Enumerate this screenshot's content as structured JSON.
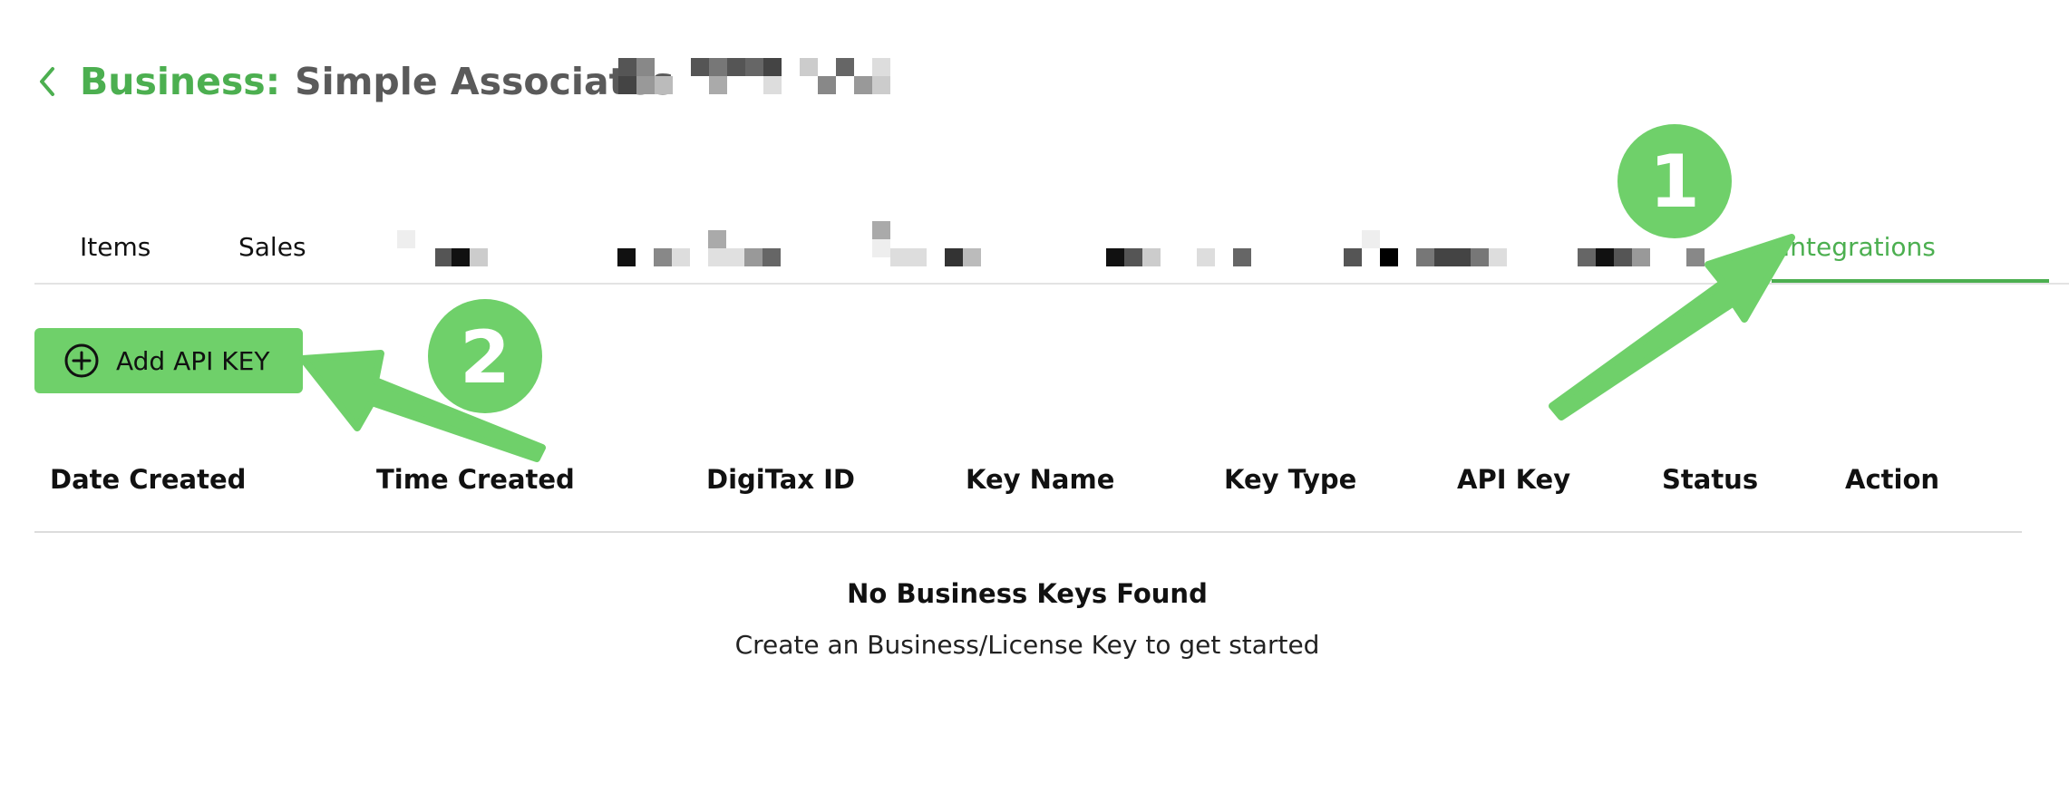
{
  "header": {
    "back_icon": "chevron-left-icon",
    "label": "Business:",
    "name": "Simple Associates"
  },
  "tabs": [
    {
      "label": "Items"
    },
    {
      "label": "Sales"
    },
    {
      "label": "Integrations",
      "active": true
    }
  ],
  "add_button": {
    "label": "Add API KEY",
    "icon": "plus-circle-icon"
  },
  "table": {
    "columns": [
      "Date Created",
      "Time Created",
      "DigiTax ID",
      "Key Name",
      "Key Type",
      "API Key",
      "Status",
      "Action"
    ]
  },
  "empty_state": {
    "title": "No Business Keys Found",
    "subtitle": "Create an Business/License Key to get started"
  },
  "annotations": {
    "step1": "1",
    "step2": "2",
    "color": "#6fd06a"
  },
  "colors": {
    "accent": "#4caf50",
    "button": "#6fd06a",
    "title_gray": "#5a5a5a"
  }
}
